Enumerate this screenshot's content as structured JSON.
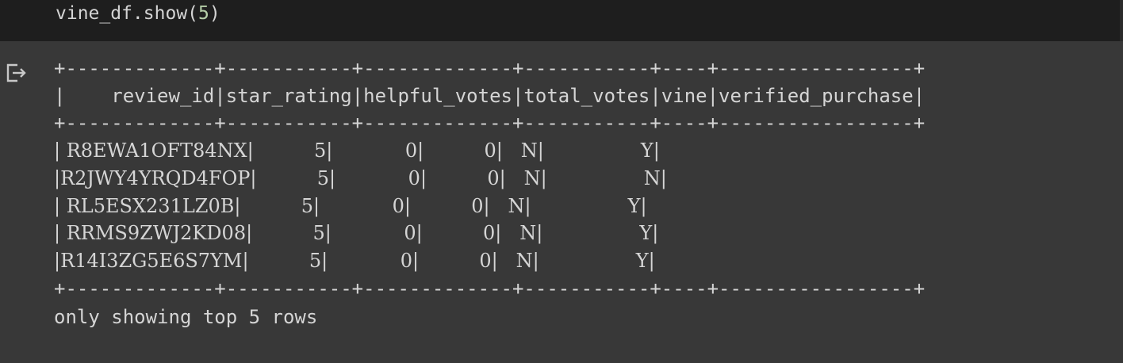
{
  "code_cell": {
    "code_prefix": "vine_df.show(",
    "code_arg": "5",
    "code_suffix": ")"
  },
  "output": {
    "icon": "output-redirect-icon",
    "table": {
      "border": "+-------------+-----------+-------------+-----------+----+-----------------+",
      "header": "|    review_id|star_rating|helpful_votes|total_votes|vine|verified_purchase|",
      "columns": [
        "review_id",
        "star_rating",
        "helpful_votes",
        "total_votes",
        "vine",
        "verified_purchase"
      ],
      "rows": [
        "| R8EWA1OFT84NX|          5|            0|          0|   N|                Y|",
        "|R2JWY4YRQD4FOP|          5|            0|          0|   N|                N|",
        "| RL5ESX231LZ0B|          5|            0|          0|   N|                Y|",
        "| RRMS9ZWJ2KD08|          5|            0|          0|   N|                Y|",
        "|R14I3ZG5E6S7YM|          5|            0|          0|   N|                Y|"
      ]
    },
    "footer": "only showing top 5 rows"
  }
}
